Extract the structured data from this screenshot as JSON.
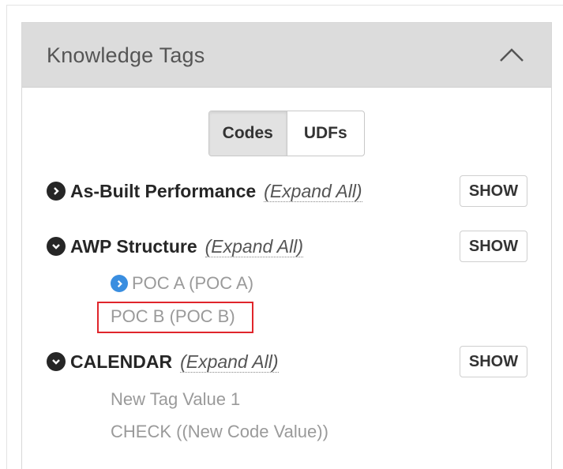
{
  "panel": {
    "title": "Knowledge Tags",
    "collapse_icon": "chevron-up-icon"
  },
  "toggle": {
    "codes_label": "Codes",
    "udfs_label": "UDFs",
    "active": "Codes"
  },
  "categories": [
    {
      "name": "As-Built Performance",
      "expand_label": "(Expand All)",
      "show_label": "SHOW",
      "icon": "chevron-right-circle-icon",
      "expanded": false,
      "children": []
    },
    {
      "name": "AWP Structure",
      "expand_label": "(Expand All)",
      "show_label": "SHOW",
      "icon": "chevron-down-circle-icon",
      "expanded": true,
      "children": [
        {
          "label": "POC A (POC A)",
          "has_children": true,
          "icon": "chevron-right-circle-icon"
        },
        {
          "label": "POC B (POC B)",
          "has_children": false,
          "highlighted": true
        }
      ]
    },
    {
      "name": "CALENDAR",
      "expand_label": "(Expand All)",
      "show_label": "SHOW",
      "icon": "chevron-down-circle-icon",
      "expanded": true,
      "children": [
        {
          "label": "New Tag Value 1",
          "has_children": false
        },
        {
          "label": "CHECK ((New Code Value))",
          "has_children": false
        }
      ]
    }
  ],
  "colors": {
    "header_bg": "#dcdcdc",
    "highlight": "#e0252b",
    "node_icon_blue": "#3a8ee0",
    "muted_text": "#9a9a9a"
  }
}
